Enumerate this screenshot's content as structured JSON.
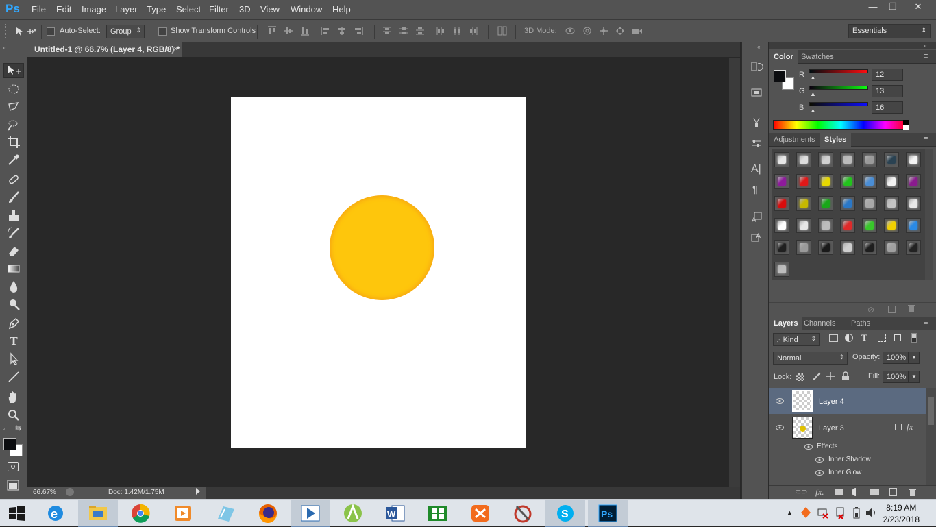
{
  "app": {
    "logo": "Ps",
    "name": "Adobe Photoshop"
  },
  "menu": [
    "File",
    "Edit",
    "Image",
    "Layer",
    "Type",
    "Select",
    "Filter",
    "3D",
    "View",
    "Window",
    "Help"
  ],
  "window_controls": {
    "minimize": "—",
    "restore": "❐",
    "close": "✕"
  },
  "options_bar": {
    "auto_select_label": "Auto-Select:",
    "auto_select_value": "Group",
    "show_transform_label": "Show Transform Controls",
    "mode_3d_label": "3D Mode:",
    "workspace": "Essentials"
  },
  "document_tab": {
    "title": "Untitled-1 @ 66.7% (Layer 4, RGB/8) *",
    "close": "×"
  },
  "canvas": {
    "background": "#ffffff",
    "circle_color": "#fec60c",
    "circle_edge": "#f6a414"
  },
  "status_bar": {
    "zoom": "66.67%",
    "doc_size": "Doc: 1.42M/1.75M"
  },
  "color_panel": {
    "tabs": [
      "Color",
      "Swatches"
    ],
    "channels": [
      {
        "label": "R",
        "value": "12"
      },
      {
        "label": "G",
        "value": "13"
      },
      {
        "label": "B",
        "value": "16"
      }
    ],
    "foreground": "#0c0d10",
    "background": "#ffffff"
  },
  "styles_panel": {
    "tabs": [
      "Adjustments",
      "Styles"
    ],
    "active_tab": "Styles",
    "swatch_colors": [
      "#e6e6e6",
      "#dddddd",
      "#d0d0d0",
      "#bbbbbb",
      "#9a9a9a",
      "#2a4252",
      "#f4f4f4",
      "#8e1a9c",
      "#e01818",
      "#e6d800",
      "#22c41c",
      "#4a8ed6",
      "#f2f2f2",
      "#8a1a8e",
      "#d80c0c",
      "#c6b800",
      "#18a818",
      "#2a78c8",
      "#a8a8a8",
      "#c4c4c4",
      "#e8e8e8",
      "#ffffff",
      "#e6e6e6",
      "#bdbdbd",
      "#e02a2a",
      "#38c82a",
      "#f0d000",
      "#2a8ae6",
      "#202020",
      "#9a9a9a",
      "#1a1a1a",
      "#cfcfcf",
      "#1e1e1e",
      "#a0a0a0",
      "#222222",
      "#bdbdbd"
    ]
  },
  "layers_panel": {
    "tabs": [
      "Layers",
      "Channels",
      "Paths"
    ],
    "filter_kind": "Kind",
    "blend_mode": "Normal",
    "opacity_label": "Opacity:",
    "opacity_value": "100%",
    "lock_label": "Lock:",
    "fill_label": "Fill:",
    "fill_value": "100%",
    "layers": [
      {
        "name": "Layer 4",
        "selected": true
      },
      {
        "name": "Layer 3",
        "selected": false,
        "fx": "fx"
      }
    ],
    "effects_label": "Effects",
    "effects": [
      "Inner Shadow",
      "Inner Glow"
    ]
  },
  "taskbar": {
    "apps": [
      "Start",
      "Internet Explorer",
      "File Explorer",
      "Google Chrome",
      "Media Player",
      "Snipping Tool",
      "Firefox",
      "Media Player 2",
      "Android Studio",
      "Word",
      "Excel",
      "XAMPP",
      "Pipe",
      "Skype",
      "Photoshop"
    ],
    "time": "8:19 AM",
    "date": "2/23/2018"
  }
}
